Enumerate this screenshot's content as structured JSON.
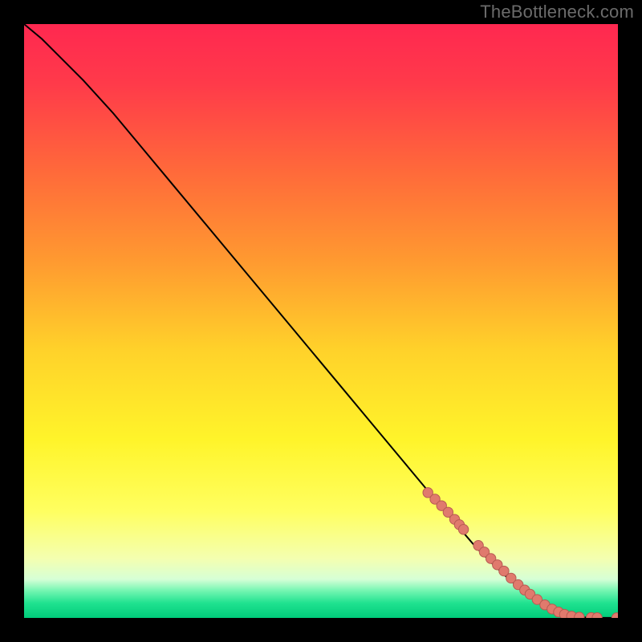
{
  "attribution": "TheBottleneck.com",
  "palette": {
    "bg_black": "#000000",
    "curve_color": "#000000",
    "dot_fill": "#e07a6d",
    "dot_stroke": "#b75b52",
    "grad_stops": [
      {
        "offset": 0.0,
        "color": "#ff2850"
      },
      {
        "offset": 0.1,
        "color": "#ff3a4a"
      },
      {
        "offset": 0.25,
        "color": "#ff6a3a"
      },
      {
        "offset": 0.4,
        "color": "#ff9a30"
      },
      {
        "offset": 0.55,
        "color": "#ffd22a"
      },
      {
        "offset": 0.7,
        "color": "#fff42a"
      },
      {
        "offset": 0.82,
        "color": "#ffff60"
      },
      {
        "offset": 0.9,
        "color": "#f4ffb0"
      },
      {
        "offset": 0.935,
        "color": "#d6ffd6"
      },
      {
        "offset": 0.955,
        "color": "#70f5b0"
      },
      {
        "offset": 0.975,
        "color": "#20e290"
      },
      {
        "offset": 1.0,
        "color": "#00cc7a"
      }
    ]
  },
  "chart_data": {
    "type": "line",
    "title": "",
    "xlabel": "",
    "ylabel": "",
    "xlim": [
      0,
      100
    ],
    "ylim": [
      0,
      100
    ],
    "grid": false,
    "series": [
      {
        "name": "curve",
        "x": [
          0,
          3,
          6,
          10,
          15,
          20,
          25,
          30,
          35,
          40,
          45,
          50,
          55,
          60,
          65,
          70,
          73,
          76,
          79,
          82,
          85,
          88,
          90,
          91.5,
          93,
          95,
          97,
          100
        ],
        "y": [
          100,
          97.5,
          94.5,
          90.5,
          85,
          79,
          73,
          67,
          61,
          55,
          49,
          43,
          37,
          31,
          25,
          19,
          15.5,
          12,
          9,
          6.2,
          4,
          2.2,
          1.2,
          0.6,
          0.2,
          0.05,
          0.02,
          0.01
        ]
      }
    ],
    "scatter": [
      {
        "name": "dots",
        "points": [
          {
            "x": 68.0,
            "y": 21.1
          },
          {
            "x": 69.2,
            "y": 20.0
          },
          {
            "x": 70.3,
            "y": 18.9
          },
          {
            "x": 71.4,
            "y": 17.8
          },
          {
            "x": 72.5,
            "y": 16.6
          },
          {
            "x": 73.3,
            "y": 15.7
          },
          {
            "x": 74.0,
            "y": 14.9
          },
          {
            "x": 76.5,
            "y": 12.2
          },
          {
            "x": 77.5,
            "y": 11.1
          },
          {
            "x": 78.6,
            "y": 10.0
          },
          {
            "x": 79.7,
            "y": 8.95
          },
          {
            "x": 80.8,
            "y": 7.9
          },
          {
            "x": 82.0,
            "y": 6.7
          },
          {
            "x": 83.2,
            "y": 5.6
          },
          {
            "x": 84.3,
            "y": 4.7
          },
          {
            "x": 85.2,
            "y": 4.0
          },
          {
            "x": 86.4,
            "y": 3.1
          },
          {
            "x": 87.7,
            "y": 2.2
          },
          {
            "x": 88.9,
            "y": 1.5
          },
          {
            "x": 90.0,
            "y": 1.0
          },
          {
            "x": 91.0,
            "y": 0.6
          },
          {
            "x": 92.2,
            "y": 0.3
          },
          {
            "x": 93.5,
            "y": 0.12
          },
          {
            "x": 95.5,
            "y": 0.05
          },
          {
            "x": 96.5,
            "y": 0.04
          },
          {
            "x": 99.8,
            "y": 0.02
          }
        ]
      }
    ]
  }
}
